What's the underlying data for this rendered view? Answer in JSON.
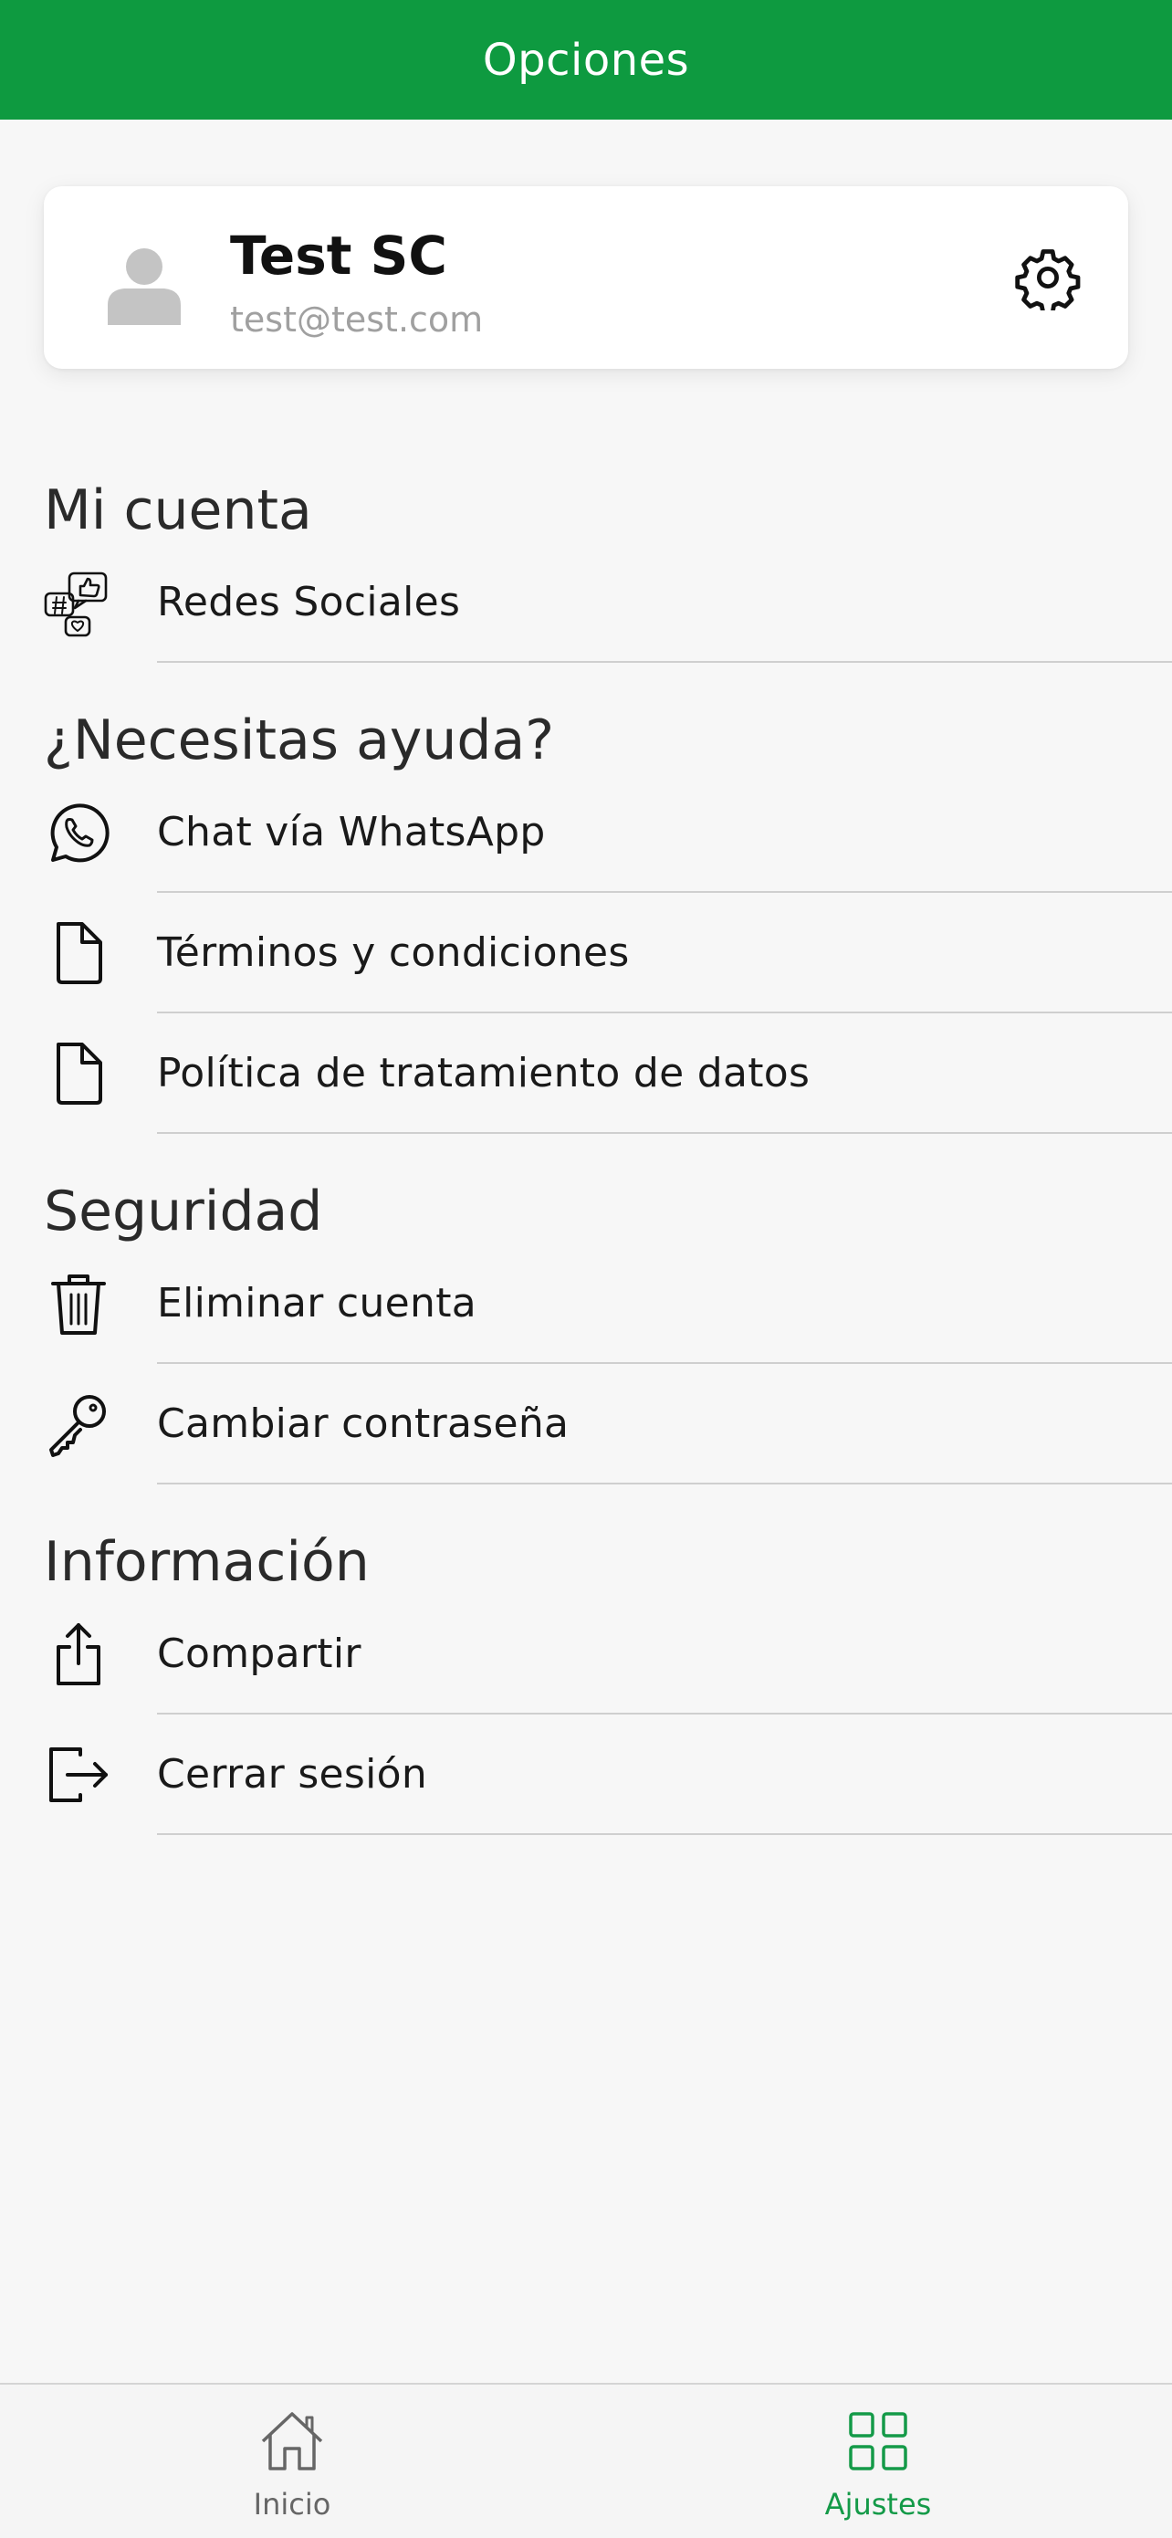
{
  "app_bar": {
    "title": "Opciones",
    "color": "#0e9a40"
  },
  "profile": {
    "name": "Test SC",
    "email": "test@test.com",
    "avatar_icon": "person-icon",
    "settings_icon": "gear-icon"
  },
  "sections": {
    "mi_cuenta": {
      "title": "Mi cuenta",
      "items": [
        {
          "label": "Redes Sociales",
          "icon": "social-media-icon"
        }
      ]
    },
    "ayuda": {
      "title": "¿Necesitas ayuda?",
      "items": [
        {
          "label": "Chat vía WhatsApp",
          "icon": "whatsapp-icon"
        },
        {
          "label": "Términos y condiciones",
          "icon": "document-icon"
        },
        {
          "label": "Política de tratamiento de datos",
          "icon": "document-icon"
        }
      ]
    },
    "seguridad": {
      "title": "Seguridad",
      "items": [
        {
          "label": "Eliminar cuenta",
          "icon": "trash-icon"
        },
        {
          "label": "Cambiar contraseña",
          "icon": "key-icon"
        }
      ]
    },
    "informacion": {
      "title": "Información",
      "items": [
        {
          "label": "Compartir",
          "icon": "share-icon"
        },
        {
          "label": "Cerrar sesión",
          "icon": "logout-icon"
        }
      ]
    }
  },
  "bottom_nav": {
    "items": [
      {
        "label": "Inicio",
        "icon": "home-icon",
        "active": false
      },
      {
        "label": "Ajustes",
        "icon": "grid-icon",
        "active": true
      }
    ],
    "active_color": "#149a48",
    "inactive_color": "#666666"
  }
}
